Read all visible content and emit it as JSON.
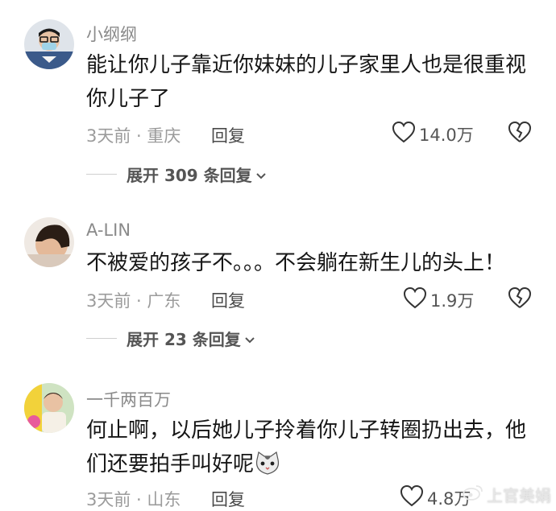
{
  "comments": [
    {
      "username": "小纲纲",
      "text": "能让你儿子靠近你妹妹的儿子家里人也是很重视你儿子了",
      "meta": "3天前 · 重庆",
      "reply_label": "回复",
      "likes": "14.0万",
      "expand": "展开 309 条回复"
    },
    {
      "username": "A-LIN",
      "text": "不被爱的孩子不。。。不会躺在新生儿的头上！",
      "meta": "3天前 · 广东",
      "reply_label": "回复",
      "likes": "1.9万",
      "expand": "展开 23 条回复"
    },
    {
      "username": "一千两百万",
      "text": "何止啊，以后她儿子拎着你儿子转圈扔出去，他们还要拍手叫好呢",
      "meta": "3天前 · 山东",
      "reply_label": "回复",
      "likes": "4.8万"
    }
  ],
  "watermark": "上官美娟",
  "colors": {
    "text": "#161616",
    "meta": "#9b9b9b",
    "username": "#8a8a8a"
  }
}
